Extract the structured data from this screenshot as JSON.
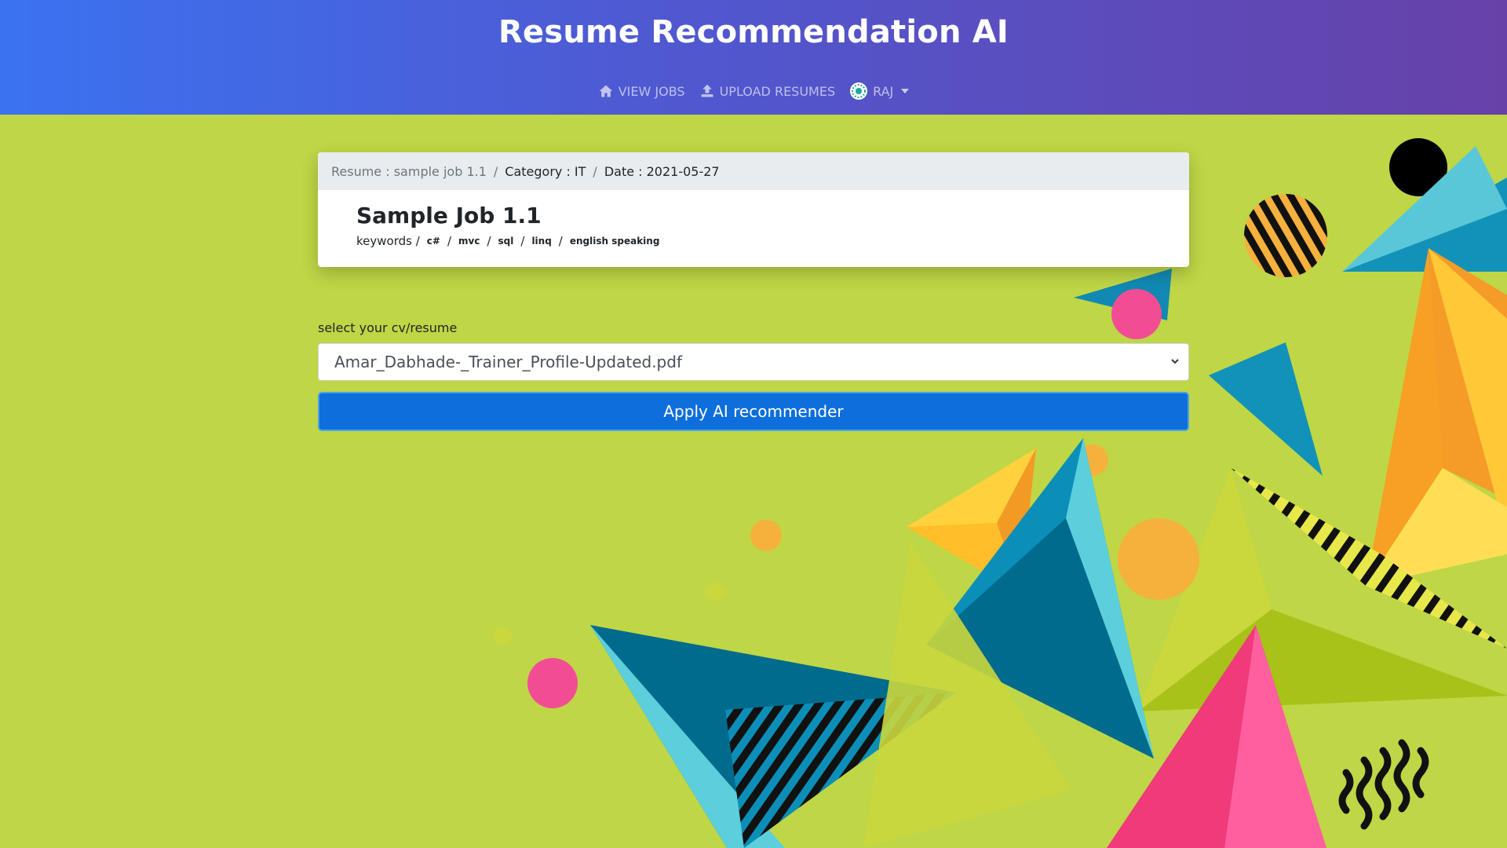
{
  "header": {
    "title": "Resume Recommendation AI",
    "nav": [
      {
        "icon": "home-icon",
        "label": "VIEW JOBS"
      },
      {
        "icon": "upload-icon",
        "label": "UPLOAD RESUMES"
      },
      {
        "icon": "user-avatar-icon",
        "label": "RAJ"
      }
    ]
  },
  "job_card": {
    "breadcrumb": [
      "Resume : sample job 1.1",
      "Category : IT",
      "Date : 2021-05-27"
    ],
    "title": "Sample Job 1.1",
    "keywords_label": "keywords /",
    "keywords": [
      "c#",
      "mvc",
      "sql",
      "linq",
      "english speaking"
    ]
  },
  "resume_select": {
    "label": "select your cv/resume",
    "selected": "Amar_Dabhade-_Trainer_Profile-Updated.pdf"
  },
  "apply_button": {
    "label": "Apply AI recommender"
  },
  "colors": {
    "header_gradient_start": "#3b72f0",
    "header_gradient_end": "#6741a8",
    "background": "#bfd646",
    "button": "#0d6edc"
  }
}
